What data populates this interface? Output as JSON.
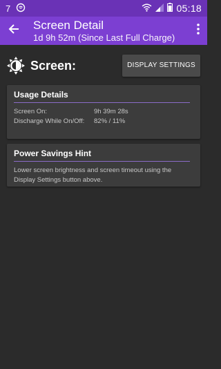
{
  "status_bar": {
    "notification_count": "7",
    "time": "05:18"
  },
  "app_bar": {
    "title": "Screen Detail",
    "subtitle": "1d 9h 52m (Since Last Full Charge)"
  },
  "header": {
    "label": "Screen:",
    "button_label": "DISPLAY SETTINGS"
  },
  "usage": {
    "title": "Usage Details",
    "rows": [
      {
        "key": "Screen On:",
        "value": "9h 39m 28s"
      },
      {
        "key": "Discharge While On/Off:",
        "value": "82% / 11%"
      }
    ]
  },
  "hint": {
    "title": "Power Savings Hint",
    "text": "Lower screen brightness and screen timeout using the Display Settings button above."
  },
  "colors": {
    "status_bar": "#6a32b6",
    "app_bar": "#7c3fd2",
    "accent_rule": "#8b6cc9",
    "background": "#2b2b2b",
    "card": "#3c3c3c"
  },
  "icons": [
    "notification-icon",
    "wifi-icon",
    "signal-icon",
    "battery-icon",
    "back-arrow-icon",
    "overflow-menu-icon",
    "brightness-icon"
  ]
}
